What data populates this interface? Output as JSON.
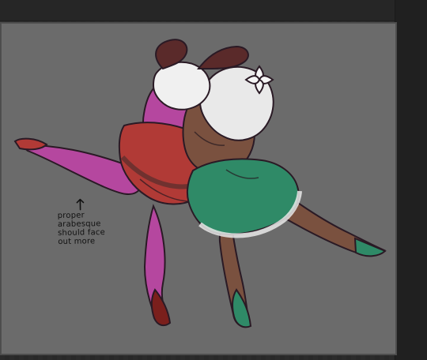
{
  "canvas": {
    "note_lines": [
      "proper",
      "arabesque",
      "should face",
      "out more"
    ]
  },
  "palette": {
    "canvas_gray": "#6b6b6b",
    "left_figure_skin": "#b5479f",
    "left_tutu": "#b13a36",
    "right_figure_skin": "#7a513f",
    "right_skirt": "#2f8a67",
    "right_hair": "#e9e9e9"
  }
}
